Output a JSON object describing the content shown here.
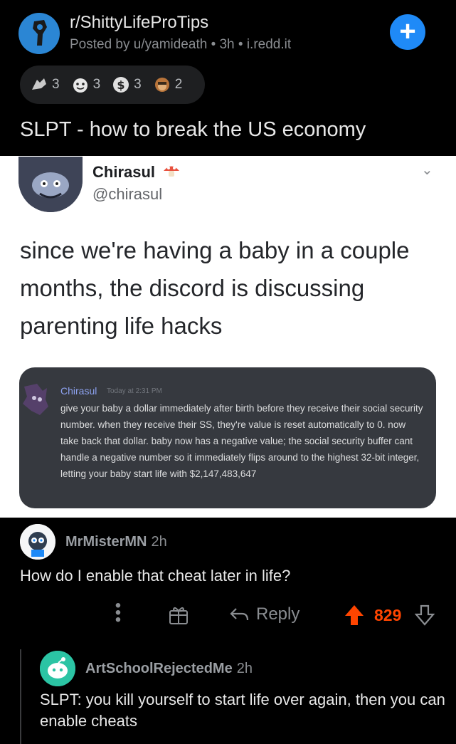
{
  "header": {
    "subreddit": "r/ShittyLifeProTips",
    "meta": "Posted by u/yamideath • 3h • i.redd.it"
  },
  "awards": [
    {
      "icon": "silver-award-icon",
      "count": "3"
    },
    {
      "icon": "wholesome-award-icon",
      "count": "3"
    },
    {
      "icon": "dollar-award-icon",
      "count": "3"
    },
    {
      "icon": "monkey-award-icon",
      "count": "2"
    }
  ],
  "post": {
    "title": "SLPT - how to break the US economy"
  },
  "tweet": {
    "name": "Chirasul",
    "handle": "@chirasul",
    "body": "since we're having a baby in a couple months, the discord is discussing parenting life hacks",
    "discord": {
      "name": "Chirasul",
      "time": "Today at 2:31 PM",
      "message": "give your baby a dollar immediately after birth before they receive their social security number. when they receive their SS, they're value is reset automatically to 0. now take back that dollar. baby now has a negative value; the social security buffer cant handle a negative number so it immediately flips around to the highest 32-bit integer, letting your baby start life with $2,147,483,647"
    }
  },
  "comments": [
    {
      "user": "MrMisterMN",
      "time": "2h",
      "body": "How do I enable that cheat later in life?",
      "reply_label": "Reply",
      "score": "829"
    },
    {
      "user": "ArtSchoolRejectedMe",
      "time": "2h",
      "body": "SLPT: you kill yourself to start life over again, then you can enable cheats"
    }
  ],
  "colors": {
    "background": "#000000",
    "accent_blue": "#1f8af7",
    "upvote": "#ff4500",
    "discord_bg": "#36393f"
  }
}
